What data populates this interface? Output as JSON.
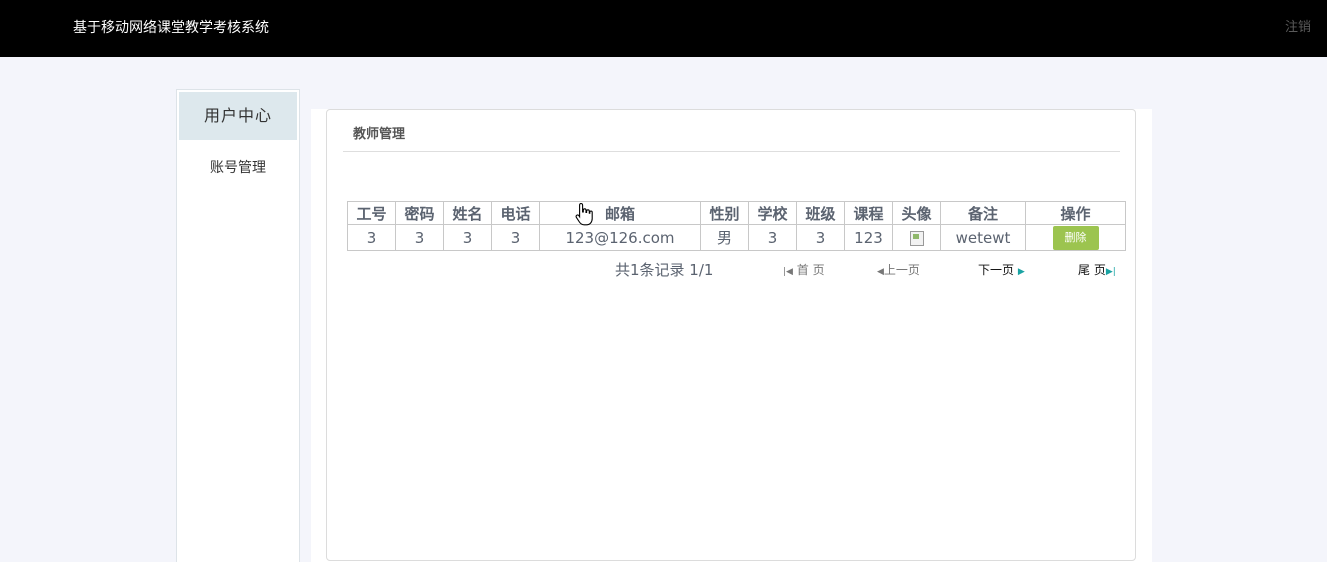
{
  "header": {
    "app_title": "基于移动网络课堂教学考核系统",
    "logout_label": "注销"
  },
  "sidebar": {
    "title": "用户中心",
    "items": [
      {
        "label": "账号管理"
      }
    ]
  },
  "panel": {
    "title": "教师管理"
  },
  "table": {
    "columns": [
      "工号",
      "密码",
      "姓名",
      "电话",
      "邮箱",
      "性别",
      "学校",
      "班级",
      "课程",
      "头像",
      "备注",
      "操作"
    ],
    "rows": [
      {
        "id": "3",
        "password": "3",
        "name": "3",
        "phone": "3",
        "email": "123@126.com",
        "gender": "男",
        "school": "3",
        "class": "3",
        "course": "123",
        "note": "wetewt",
        "action_label": "删除"
      }
    ]
  },
  "pager": {
    "summary": "共1条记录 1/1",
    "first_label": "首 页",
    "prev_label": "上一页",
    "next_label": "下一页",
    "last_label": "尾 页"
  },
  "colors": {
    "topbar": "#000000",
    "page_bg": "#f4f5fb",
    "sidebar_header": "#dde8ed",
    "delete_button": "#9cc44f",
    "pager_arrow_teal": "#1aa3a3"
  }
}
